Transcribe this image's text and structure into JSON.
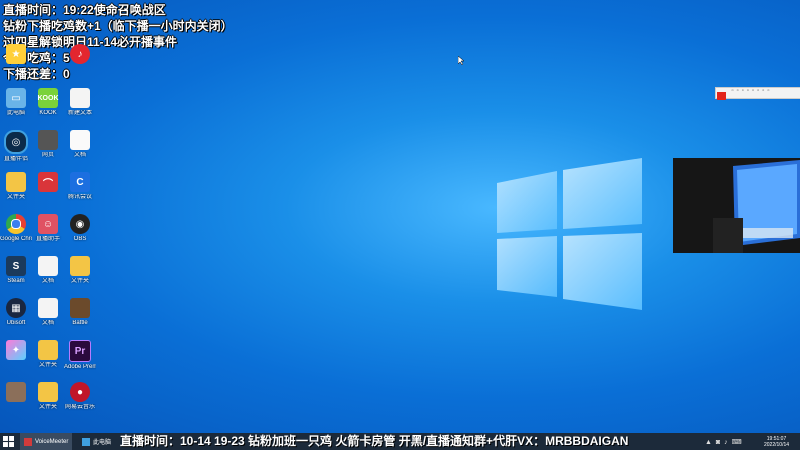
{
  "overlay": {
    "line1": "直播时间：19:22使命召唤战区",
    "line2": "钻粉下播吃鸡数+1（临下播一小时内关闭）",
    "line3": "过四星解锁明日11-14必开播事件",
    "line4": "今日吃鸡：5",
    "line5": "下播还差：0"
  },
  "desktop_icons": [
    {
      "label": "",
      "icon": "app-icon"
    },
    {
      "label": "",
      "icon": "app-icon"
    },
    {
      "label": "",
      "icon": "netease-music-icon"
    },
    {
      "label": "此电脑",
      "icon": "computer-icon"
    },
    {
      "label": "KOOK",
      "icon": "kook-icon"
    },
    {
      "label": "新建文本",
      "icon": "document-icon"
    },
    {
      "label": "直播伴侣",
      "icon": "target-icon"
    },
    {
      "label": "网页",
      "icon": "image-icon"
    },
    {
      "label": "文档",
      "icon": "document-icon"
    },
    {
      "label": "文件夹",
      "icon": "folder-icon"
    },
    {
      "label": "",
      "icon": "red-app-icon"
    },
    {
      "label": "腾讯会议",
      "icon": "blue-app-icon"
    },
    {
      "label": "Google Chrome",
      "icon": "chrome-icon"
    },
    {
      "label": "直播助手",
      "icon": "avatar-icon"
    },
    {
      "label": "OBS",
      "icon": "obs-icon"
    },
    {
      "label": "Steam",
      "icon": "steam-icon"
    },
    {
      "label": "文档",
      "icon": "document-icon"
    },
    {
      "label": "文件夹",
      "icon": "folder-icon"
    },
    {
      "label": "Ubisoft",
      "icon": "grid-icon"
    },
    {
      "label": "文档",
      "icon": "document-icon"
    },
    {
      "label": "Battle",
      "icon": "image-icon"
    },
    {
      "label": "",
      "icon": "star-icon"
    },
    {
      "label": "文件夹",
      "icon": "folder-icon"
    },
    {
      "label": "Adobe Premiere Pro",
      "icon": "premiere-icon"
    },
    {
      "label": "",
      "icon": "figure-icon"
    },
    {
      "label": "文件夹",
      "icon": "folder-icon"
    },
    {
      "label": "网易云音乐",
      "icon": "music-icon"
    }
  ],
  "ticker": {
    "text": "直播时间：10-14 19-23  钻粉加班一只鸡 火箭卡房管 开黑/直播通知群+代肝VX：MRBBDAIGAN"
  },
  "taskbar": {
    "app1_label": "VoiceMeeter",
    "app2_label": "此电脑",
    "clock_time": "19:51:07",
    "clock_date": "2022/10/14"
  },
  "colors": {
    "desktop_blue": "#0a6fd6",
    "taskbar_bg": "#1c2a3a",
    "overlay_text": "#ffffff"
  }
}
